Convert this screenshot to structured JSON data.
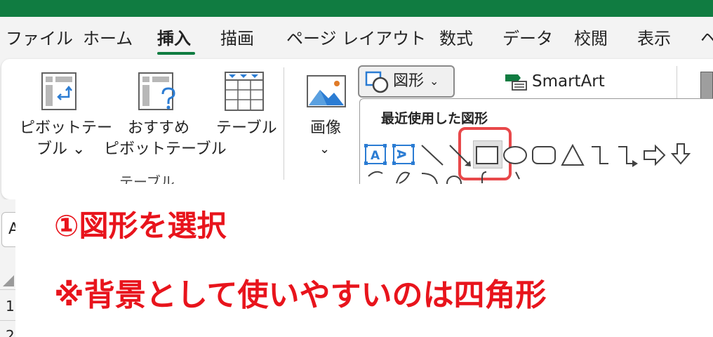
{
  "tabs": [
    {
      "label": "ファイル",
      "active": false
    },
    {
      "label": "ホーム",
      "active": false
    },
    {
      "label": "挿入",
      "active": true
    },
    {
      "label": "描画",
      "active": false
    },
    {
      "label": "ページ レイアウト",
      "active": false
    },
    {
      "label": "数式",
      "active": false
    },
    {
      "label": "データ",
      "active": false
    },
    {
      "label": "校閲",
      "active": false
    },
    {
      "label": "表示",
      "active": false
    },
    {
      "label": "ヘ",
      "active": false
    }
  ],
  "ribbon": {
    "pivot_table": {
      "line1": "ピボットテー",
      "line2": "ブル ⌄"
    },
    "recommended_pivot": {
      "line1": "おすすめ",
      "line2": "ピボットテーブル"
    },
    "table": {
      "label": "テーブル"
    },
    "group_label": "テーブル",
    "image": {
      "label": "画像",
      "chevron": "⌄"
    },
    "shapes_button": {
      "label": "図形",
      "chevron": "⌄"
    },
    "smartart": {
      "label": "SmartArt"
    },
    "shape_gallery": {
      "title": "最近使用した図形",
      "textbox_h_glyph": "A",
      "textbox_v_glyph": "A"
    }
  },
  "sheet": {
    "name_box": "A",
    "rows": [
      "1",
      "2"
    ]
  },
  "annotation": {
    "line1": "①図形を選択",
    "line2": "※背景として使いやすいのは四角形"
  },
  "colors": {
    "excel_green": "#107c41",
    "highlight_red": "#e8484a",
    "annotation_red": "#e8141c",
    "icon_blue": "#2b7cd3"
  }
}
